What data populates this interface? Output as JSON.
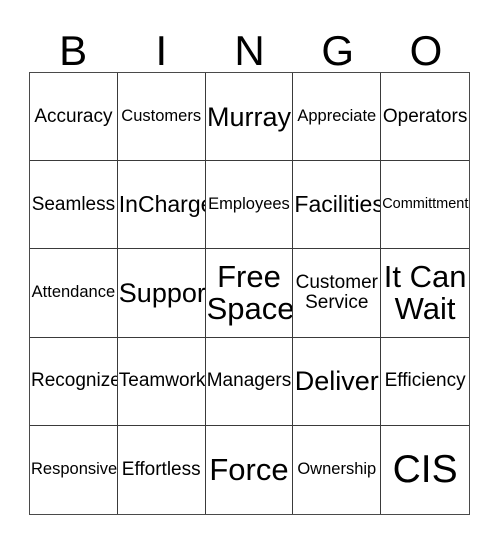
{
  "card": {
    "type": "bingo-card",
    "header_letters": [
      "B",
      "I",
      "N",
      "G",
      "O"
    ],
    "columns": 5,
    "rows": 5,
    "colors": {
      "background": "#ffffff",
      "text": "#000000",
      "grid_line": "#3a3a3a",
      "outer_border": "#4a4a4a"
    },
    "cells": [
      [
        {
          "text": "Accuracy",
          "size": "fs-m"
        },
        {
          "text": "Customers",
          "size": "fs-s"
        },
        {
          "text": "Murray",
          "size": "fs-xl"
        },
        {
          "text": "Appreciate",
          "size": "fs-s"
        },
        {
          "text": "Operators",
          "size": "fs-m"
        }
      ],
      [
        {
          "text": "Seamless",
          "size": "fs-m"
        },
        {
          "text": "InCharge",
          "size": "fs-l"
        },
        {
          "text": "Employees",
          "size": "fs-s"
        },
        {
          "text": "Facilities",
          "size": "fs-l"
        },
        {
          "text": "Committment",
          "size": "fs-xs"
        }
      ],
      [
        {
          "text": "Attendance",
          "size": "fs-s"
        },
        {
          "text": "Support",
          "size": "fs-xl"
        },
        {
          "text": "Free Space",
          "size": "fs-xxl"
        },
        {
          "text": "Customer Service",
          "size": "fs-m"
        },
        {
          "text": "It Can Wait",
          "size": "fs-xxl"
        }
      ],
      [
        {
          "text": "Recognize",
          "size": "fs-m"
        },
        {
          "text": "Teamwork",
          "size": "fs-m"
        },
        {
          "text": "Managers",
          "size": "fs-m"
        },
        {
          "text": "Deliver",
          "size": "fs-xl"
        },
        {
          "text": "Efficiency",
          "size": "fs-m"
        }
      ],
      [
        {
          "text": "Responsive",
          "size": "fs-s"
        },
        {
          "text": "Effortless",
          "size": "fs-m"
        },
        {
          "text": "Force",
          "size": "fs-xxl"
        },
        {
          "text": "Ownership",
          "size": "fs-s"
        },
        {
          "text": "CIS",
          "size": "fs-huge"
        }
      ]
    ]
  }
}
